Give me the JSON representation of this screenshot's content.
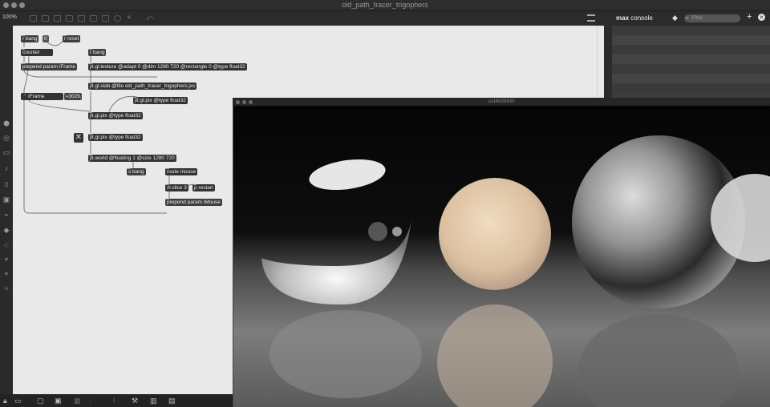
{
  "window": {
    "title": "old_path_tracer_trigophers"
  },
  "toolbar": {
    "zoom": "100%"
  },
  "console": {
    "title_bold": "max",
    "title_rest": " console",
    "filter_placeholder": "Filter",
    "add": "+",
    "clear": "×"
  },
  "patch": {
    "objects": {
      "r_bang_1": "r bang",
      "num_0": "0",
      "r_reset": "r reset",
      "counter": "counter",
      "r_bang_2": "r bang",
      "prepend_iframe": "prepend param iFrame",
      "jit_texture": "jit.gl.texture @adapt 0 @dim 1280 720 @rectangle 0 @type float32",
      "jit_slab": "jit.gl.slab @file old_path_tracer_trigophers.jxs",
      "iframe_label": "iFrame",
      "iframe_num": "3029.",
      "jit_pix_a": "jit.gl.pix @type float32",
      "jit_pix_b": "jit.gl.pix @type float32",
      "jit_pix_c": "jit.gl.pix @type float32",
      "jit_world": "jit.world @floating 1 @size 1280 720",
      "s_bang": "s bang",
      "route_mouse": "route mouse",
      "zl_slice": "zl.slice 3",
      "p_restart": "p restart",
      "prepend_imouse": "prepend param iMouse"
    }
  },
  "render_window": {
    "title": "u116008830"
  },
  "colors": {
    "canvas": "#e9e9e9",
    "object": "#333333",
    "chrome": "#2b2b2b",
    "accent_sphere": "#e2c9a8"
  },
  "icons": {
    "sidebar": [
      "cube-icon",
      "target-icon",
      "layer-icon",
      "note-icon",
      "bracket-icon",
      "image-icon",
      "clip-icon",
      "arrow-icon",
      "link-icon",
      "circle-icon",
      "record-icon",
      "star-icon"
    ],
    "bottom": [
      "lock-icon",
      "present-icon",
      "windows-icon",
      "grid-icon",
      "dots-icon",
      "wrench-icon",
      "piano-icon",
      "keyboard-icon"
    ]
  }
}
